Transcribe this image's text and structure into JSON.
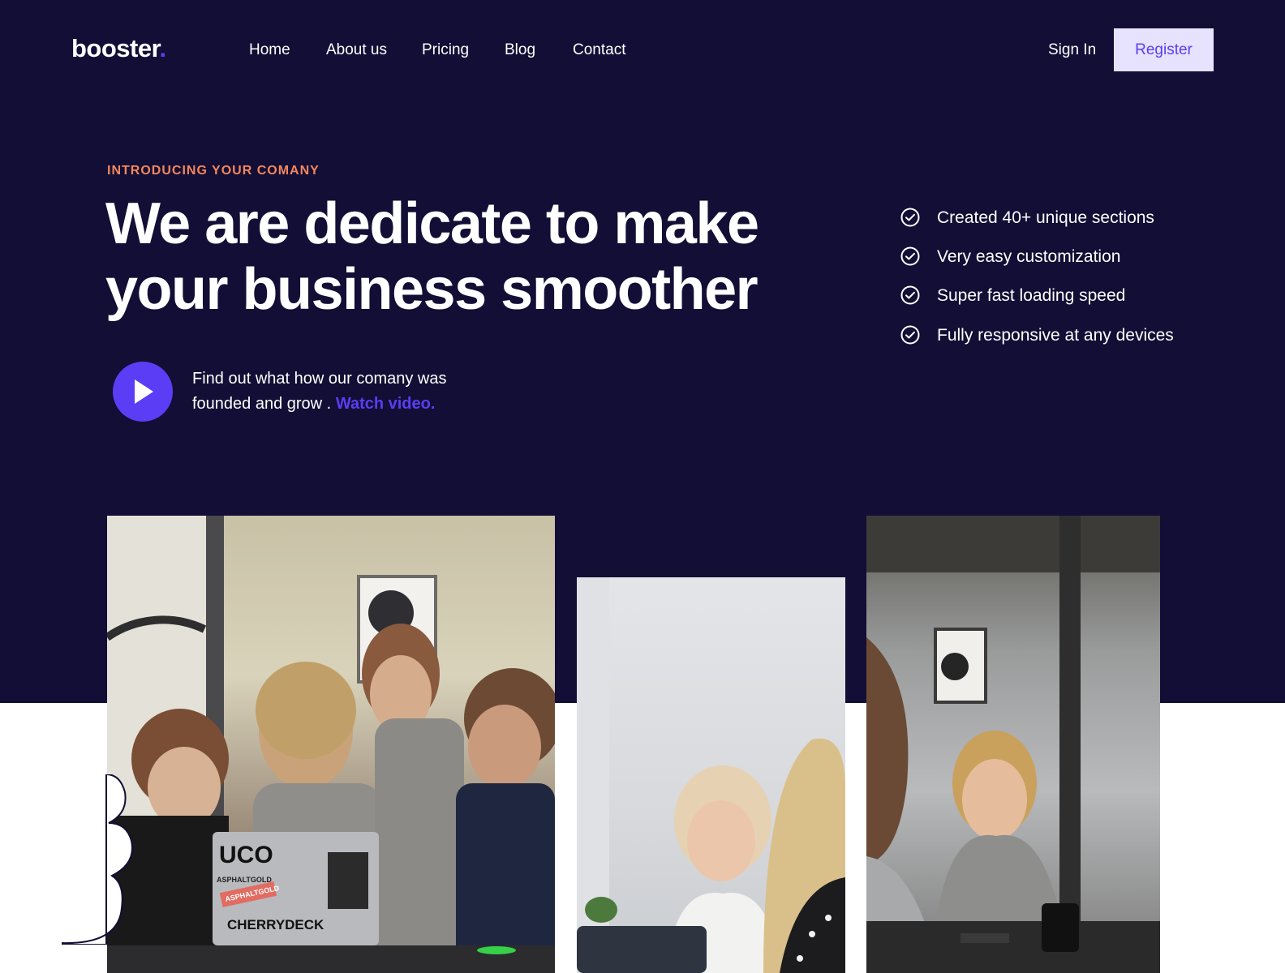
{
  "brand": {
    "name": "booster",
    "dot": ".",
    "accent": "#5b3df5",
    "background": "#130e35"
  },
  "nav": {
    "links": [
      "Home",
      "About us",
      "Pricing",
      "Blog",
      "Contact"
    ],
    "sign_in": "Sign In",
    "register": "Register"
  },
  "hero": {
    "eyebrow": "INTRODUCING YOUR COMANY",
    "headline_line1": "We are dedicate to make",
    "headline_line2": "your business smoother",
    "video_text": "Find out what how our comany was founded and grow .",
    "watch_video": "Watch video."
  },
  "features": [
    "Created 40+ unique sections",
    "Very easy customization",
    "Super fast loading speed",
    "Fully responsive at any devices"
  ],
  "photos": {
    "laptop_stickers": [
      "ASPHALTGOLD",
      "ASPHALTGOLD",
      "CHERRYDECK"
    ]
  }
}
